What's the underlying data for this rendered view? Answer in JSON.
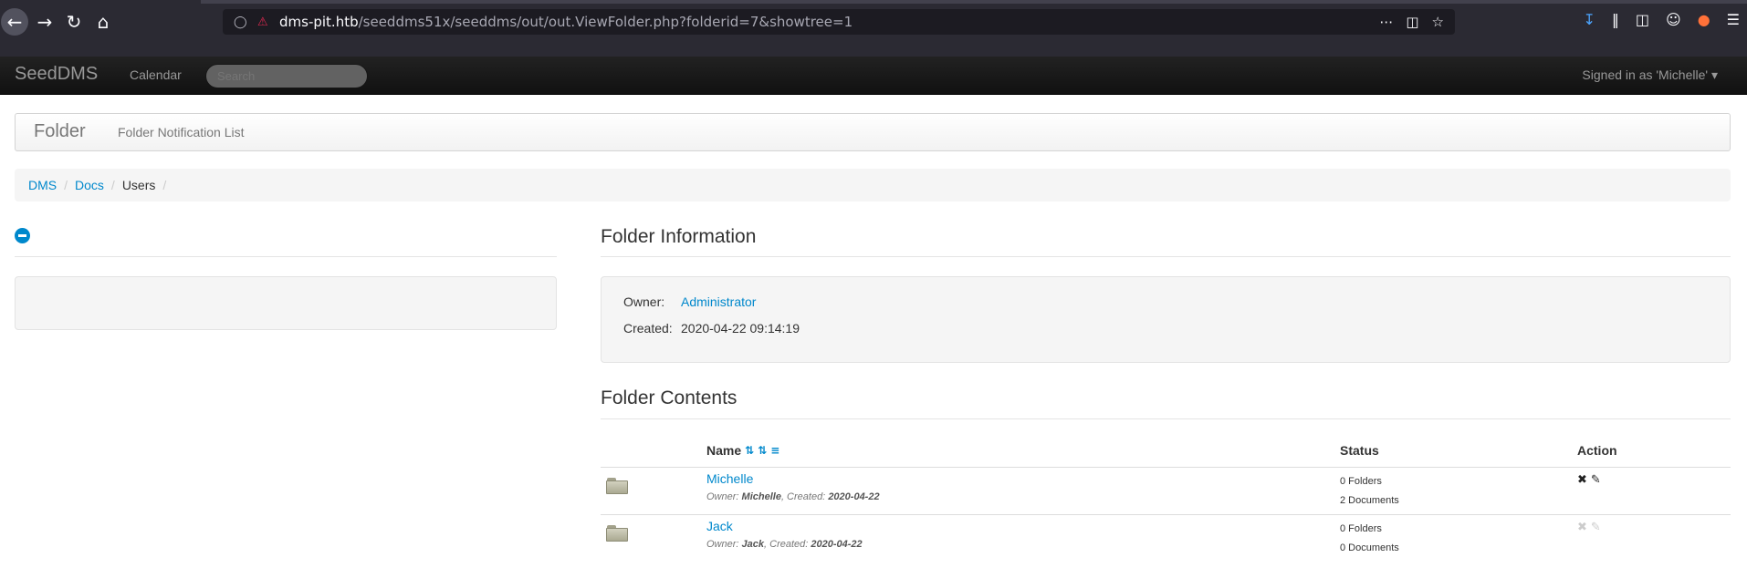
{
  "browser": {
    "url_host": "dms-pit.htb",
    "url_path": "/seeddms51x/seeddms/out/out.ViewFolder.php?folderid=7&showtree=1"
  },
  "navbar": {
    "brand": "SeedDMS",
    "calendar": "Calendar",
    "search_placeholder": "Search",
    "signed_in": "Signed in as 'Michelle'"
  },
  "header": {
    "title": "Folder",
    "link": "Folder Notification List"
  },
  "breadcrumb": {
    "items": [
      "DMS",
      "Docs"
    ],
    "current": "Users"
  },
  "folder_info": {
    "title": "Folder Information",
    "owner_label": "Owner:",
    "owner": "Administrator",
    "created_label": "Created:",
    "created": "2020-04-22 09:14:19"
  },
  "folder_contents": {
    "title": "Folder Contents",
    "columns": {
      "name": "Name",
      "status": "Status",
      "action": "Action"
    },
    "rows": [
      {
        "name": "Michelle",
        "owner_label": "Owner:",
        "owner": "Michelle",
        "created_label": ", Created:",
        "created": "2020-04-22",
        "folders": "0 Folders",
        "documents": "2 Documents"
      },
      {
        "name": "Jack",
        "owner_label": "Owner:",
        "owner": "Jack",
        "created_label": ", Created:",
        "created": "2020-04-22",
        "folders": "0 Folders",
        "documents": "0 Documents"
      }
    ]
  },
  "icons": {
    "sort_alpha": "sort-alpha-icon",
    "sort_numeric": "sort-numeric-icon",
    "sort_amount": "sort-amount-icon",
    "delete": "delete-icon",
    "edit": "edit-icon",
    "folder": "folder-icon",
    "tree_toggle": "minus-circle-icon"
  },
  "colors": {
    "link": "#0088cc",
    "navbar_bg": "#1b1b1b",
    "browser_bg": "#2b2a33"
  }
}
